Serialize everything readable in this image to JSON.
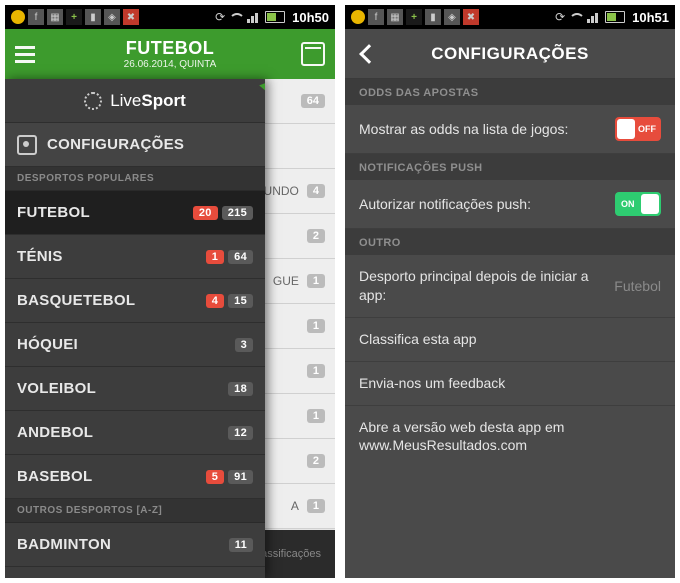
{
  "left": {
    "status": {
      "time": "10h50"
    },
    "header": {
      "title": "FUTEBOL",
      "subtitle": "26.06.2014, QUINTA"
    },
    "brand": {
      "prefix": "Live",
      "suffix": "Sport"
    },
    "config_label": "CONFIGURAÇÕES",
    "section_popular": "DESPORTOS POPULARES",
    "section_other": "OUTROS DESPORTOS [A-Z]",
    "sports": [
      {
        "name": "FUTEBOL",
        "live": "20",
        "total": "215"
      },
      {
        "name": "TÉNIS",
        "live": "1",
        "total": "64"
      },
      {
        "name": "BASQUETEBOL",
        "live": "4",
        "total": "15"
      },
      {
        "name": "HÓQUEI",
        "live": null,
        "total": "3"
      },
      {
        "name": "VOLEIBOL",
        "live": null,
        "total": "18"
      },
      {
        "name": "ANDEBOL",
        "live": null,
        "total": "12"
      },
      {
        "name": "BASEBOL",
        "live": "5",
        "total": "91"
      }
    ],
    "other_sports": [
      {
        "name": "BADMINTON",
        "live": null,
        "total": "11"
      }
    ],
    "bg": {
      "rows": [
        {
          "label": "",
          "count": "64"
        },
        {
          "label": "",
          "count": ""
        },
        {
          "label": "UNDO",
          "count": "4"
        },
        {
          "label": "",
          "count": "2"
        },
        {
          "label": "GUE",
          "count": "1"
        },
        {
          "label": "",
          "count": "1"
        },
        {
          "label": "",
          "count": "1"
        },
        {
          "label": "",
          "count": "1"
        },
        {
          "label": "",
          "count": "2"
        },
        {
          "label": "A",
          "count": "1"
        }
      ],
      "bottom_label": "Classificações"
    }
  },
  "right": {
    "status": {
      "time": "10h51"
    },
    "header": {
      "title": "CONFIGURAÇÕES"
    },
    "sections": {
      "odds": "ODDS DAS APOSTAS",
      "push": "NOTIFICAÇÕES PUSH",
      "other": "OUTRO"
    },
    "rows": {
      "show_odds": {
        "label": "Mostrar as odds na lista de jogos:",
        "state": "OFF"
      },
      "push_auth": {
        "label": "Autorizar notificações push:",
        "state": "ON"
      },
      "default_sport": {
        "label": "Desporto principal depois de iniciar a app:",
        "value": "Futebol"
      },
      "rate": {
        "label": "Classifica esta app"
      },
      "feedback": {
        "label": "Envia-nos um feedback"
      },
      "web": {
        "label": "Abre a versão web desta app em www.MeusResultados.com"
      }
    }
  }
}
